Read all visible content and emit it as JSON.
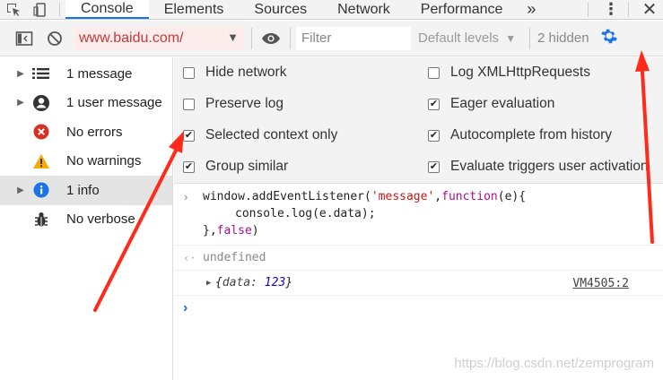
{
  "tabbar": {
    "tabs": [
      {
        "label": "Console",
        "active": true
      },
      {
        "label": "Elements"
      },
      {
        "label": "Sources"
      },
      {
        "label": "Network"
      },
      {
        "label": "Performance"
      }
    ],
    "more_label": "»",
    "menu_label": "⋮",
    "close_label": "✕"
  },
  "toolbar": {
    "context_value": "www.baidu.com/",
    "filter_placeholder": "Filter",
    "levels_label": "Default levels",
    "levels_arrow": "▼",
    "hidden_label": "2 hidden"
  },
  "sidebar": {
    "items": [
      {
        "label": "1 message",
        "icon": "list-icon",
        "expandable": true
      },
      {
        "label": "1 user message",
        "icon": "user-icon",
        "expandable": true
      },
      {
        "label": "No errors",
        "icon": "error-icon",
        "expandable": false
      },
      {
        "label": "No warnings",
        "icon": "warning-icon",
        "expandable": false
      },
      {
        "label": "1 info",
        "icon": "info-icon",
        "expandable": true,
        "active": true
      },
      {
        "label": "No verbose",
        "icon": "bug-icon",
        "expandable": false
      }
    ]
  },
  "settings": {
    "left": [
      {
        "label": "Hide network",
        "checked": false
      },
      {
        "label": "Preserve log",
        "checked": false
      },
      {
        "label": "Selected context only",
        "checked": true
      },
      {
        "label": "Group similar",
        "checked": true
      }
    ],
    "right": [
      {
        "label": "Log XMLHttpRequests",
        "checked": false
      },
      {
        "label": "Eager evaluation",
        "checked": true
      },
      {
        "label": "Autocomplete from history",
        "checked": true
      },
      {
        "label": "Evaluate triggers user activation",
        "checked": true
      }
    ]
  },
  "console": {
    "input_line1_pre": "window.addEventListener(",
    "input_line1_str": "'message'",
    "input_line1_comma": ",",
    "input_line1_kw": "function",
    "input_line1_post": "(e){",
    "input_line2": "console.log(e.data);",
    "input_line3_pre": "},",
    "input_line3_kw": "false",
    "input_line3_post": ")",
    "result": "undefined",
    "obj_open": "{",
    "obj_key": "data:",
    "obj_value": "123",
    "obj_close": "}",
    "source_link": "VM4505:2"
  },
  "watermark": "https://blog.csdn.net/zemprogram",
  "colors": {
    "accent": "#1a73e8",
    "error": "#d93025",
    "warning": "#f9ab00",
    "arrow": "#ff2a1a"
  }
}
